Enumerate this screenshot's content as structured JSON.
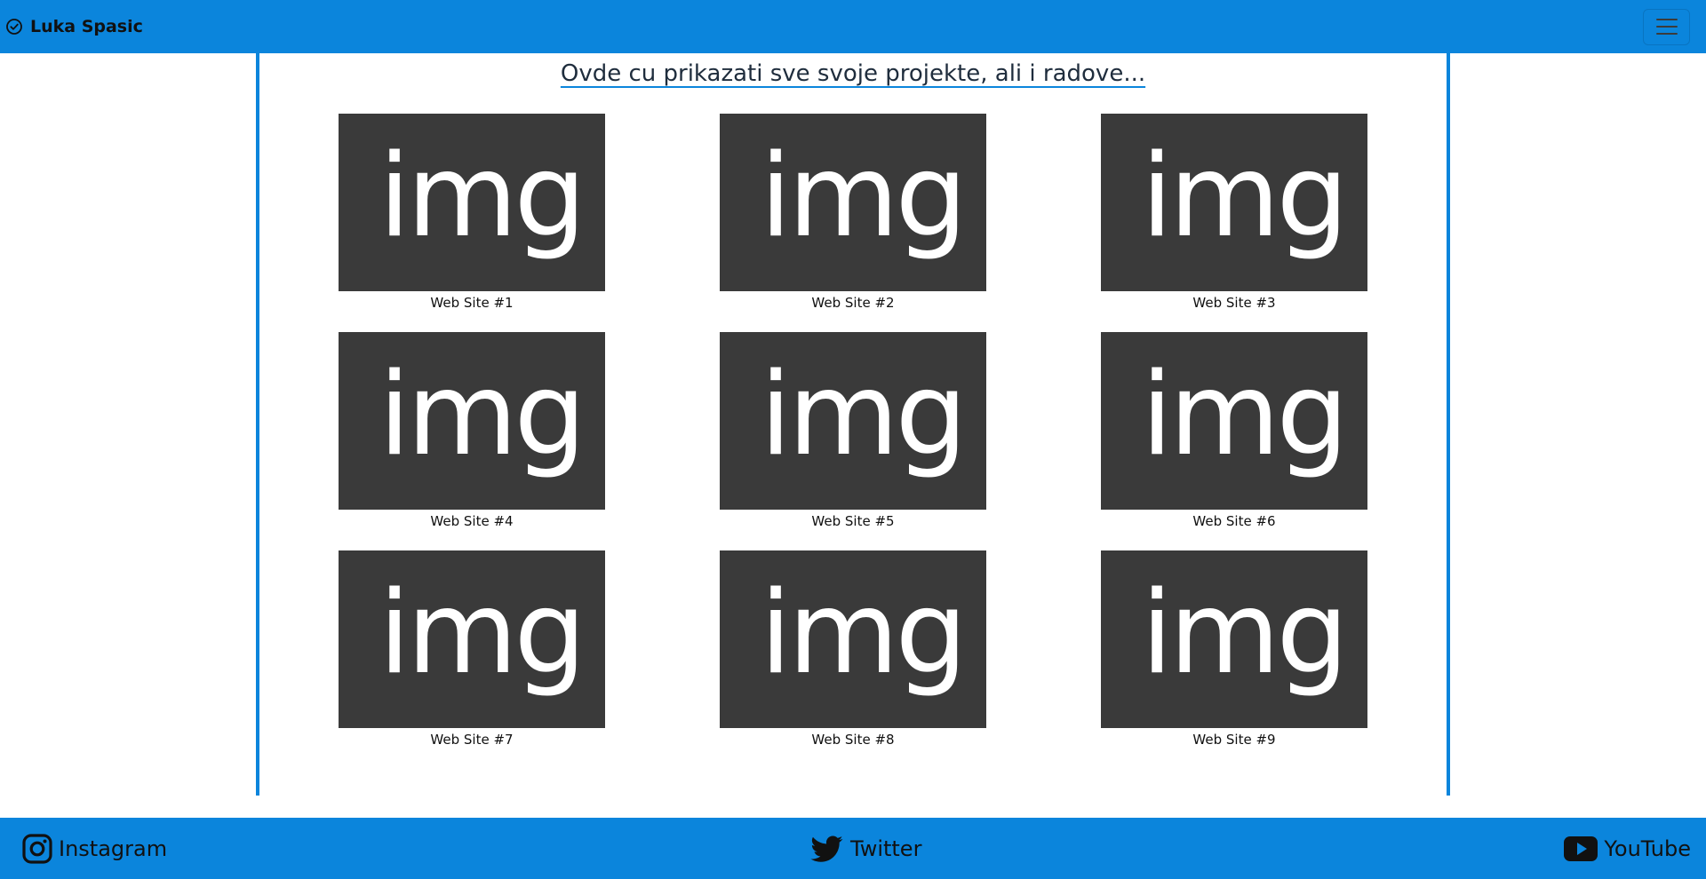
{
  "navbar": {
    "brand_label": "Luka Spasic",
    "brand_icon": "check-circle-icon",
    "toggler_icon": "hamburger-menu-icon"
  },
  "main": {
    "title": "Ovde cu prikazati sve svoje projekte, ali i radove...",
    "projects": [
      {
        "thumbnail_text": "img",
        "caption": "Web Site #1"
      },
      {
        "thumbnail_text": "img",
        "caption": "Web Site #2"
      },
      {
        "thumbnail_text": "img",
        "caption": "Web Site #3"
      },
      {
        "thumbnail_text": "img",
        "caption": "Web Site #4"
      },
      {
        "thumbnail_text": "img",
        "caption": "Web Site #5"
      },
      {
        "thumbnail_text": "img",
        "caption": "Web Site #6"
      },
      {
        "thumbnail_text": "img",
        "caption": "Web Site #7"
      },
      {
        "thumbnail_text": "img",
        "caption": "Web Site #8"
      },
      {
        "thumbnail_text": "img",
        "caption": "Web Site #9"
      }
    ]
  },
  "footer": {
    "links": [
      {
        "label": "Instagram",
        "icon": "instagram-icon"
      },
      {
        "label": "Twitter",
        "icon": "twitter-icon"
      },
      {
        "label": "YouTube",
        "icon": "youtube-icon"
      }
    ]
  },
  "colors": {
    "accent": "#0b85dc",
    "thumbnail_bg": "#3a3a3a",
    "text": "#111111"
  }
}
